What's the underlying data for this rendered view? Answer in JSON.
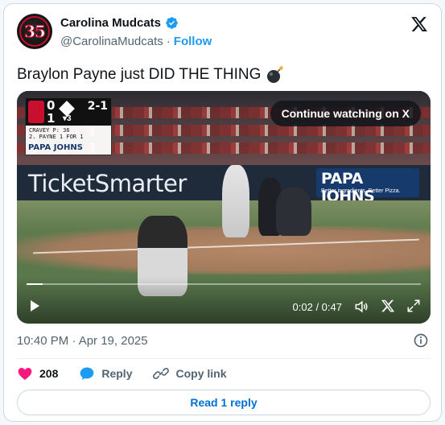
{
  "author": {
    "display_name": "Carolina Mudcats",
    "handle": "@CarolinaMudcats",
    "separator": "·",
    "follow_label": "Follow",
    "avatar_text": "35"
  },
  "tweet": {
    "text": "Braylon Payne just DID THE THING",
    "emoji": "bomb-emoji"
  },
  "media": {
    "continue_label": "Continue watching on X",
    "time_display": "0:02 / 0:47",
    "progress_fraction": 0.04,
    "banner_left": "TicketSmarter",
    "banner_right": "PAPA JOHNS",
    "banner_right_sub": "Better ingredients. Better Pizza.",
    "scorebug": {
      "score_top": "0",
      "score_bottom": "1",
      "count": "2-1",
      "inning": "▾3",
      "pitcher_line": "CRAVEY    P: 36",
      "batter_line": "2. PAYNE   1 FOR 1",
      "sponsor": "PAPA JOHNS"
    }
  },
  "meta": {
    "timestamp": "10:40 PM · Apr 19, 2025"
  },
  "actions": {
    "likes": "208",
    "reply_label": "Reply",
    "copy_label": "Copy link"
  },
  "footer": {
    "read_replies_label": "Read 1 reply"
  },
  "colors": {
    "accent": "#1d9bf0",
    "link_blue": "#006fd6",
    "heart": "#f91880",
    "muted": "#536471"
  }
}
